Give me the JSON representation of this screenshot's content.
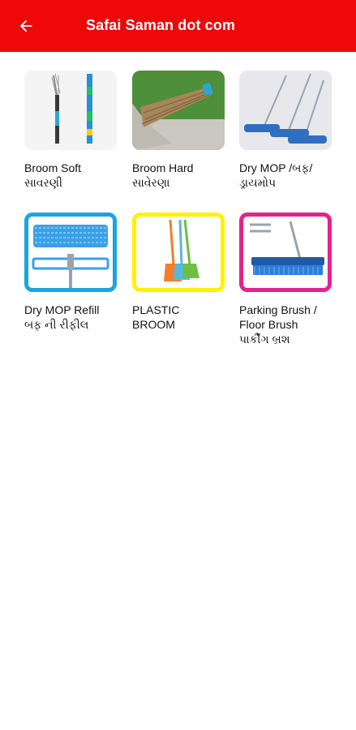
{
  "appbar": {
    "title": "Safai Saman dot com",
    "back_icon": "arrow-left-icon",
    "background": "#ee0808"
  },
  "products": [
    {
      "label": "Broom  Soft\nસાવરણી"
    },
    {
      "label": "Broom Hard\nસાવેરણા"
    },
    {
      "label": "Dry MOP  /બફ/\nડ્રાયમોપ"
    },
    {
      "label": "Dry MOP Refill\nબફ ની રીફીલ"
    },
    {
      "label": "PLASTIC\nBROOM"
    },
    {
      "label": "Parking Brush /\nFloor Brush\nપાર્કીંગ બ્રશ"
    }
  ]
}
